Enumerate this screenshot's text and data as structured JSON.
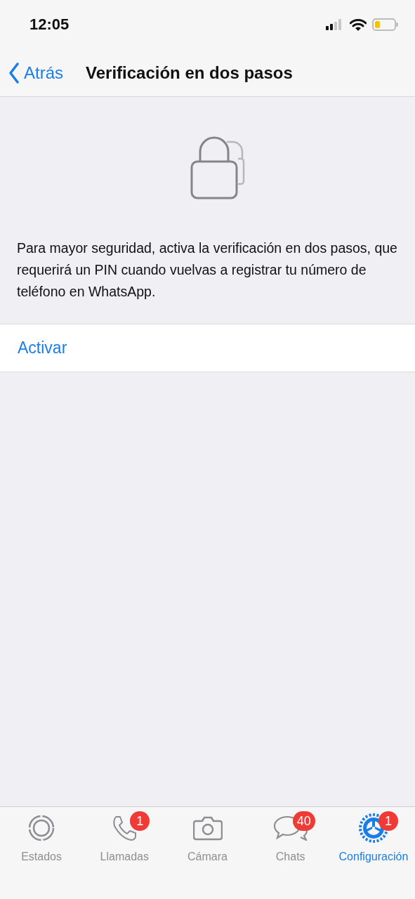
{
  "status_bar": {
    "time": "12:05"
  },
  "nav": {
    "back": "Atrás",
    "title": "Verificación en dos pasos"
  },
  "description": "Para mayor seguridad, activa la verificación en dos pasos, que requerirá un PIN cuando vuelvas a registrar tu número de teléfono en WhatsApp.",
  "action": "Activar",
  "tabs": [
    {
      "kind": "status",
      "label": "Estados",
      "selected": false
    },
    {
      "kind": "calls",
      "label": "Llamadas",
      "selected": false,
      "badge": "1"
    },
    {
      "kind": "camera",
      "label": "Cámara",
      "selected": false
    },
    {
      "kind": "chats",
      "label": "Chats",
      "selected": false,
      "badge": "40"
    },
    {
      "kind": "settings",
      "label": "Configuración",
      "selected": true,
      "badge": "1"
    }
  ]
}
